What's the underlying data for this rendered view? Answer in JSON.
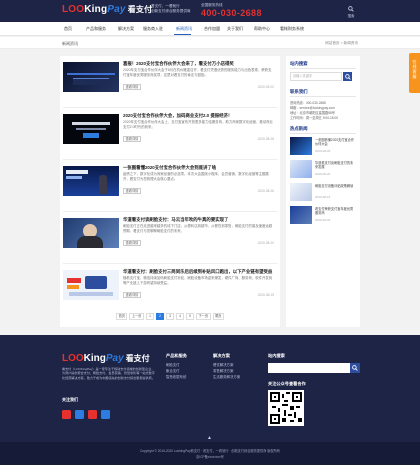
{
  "header": {
    "logo_text_a": "LOO",
    "logo_text_b": "King",
    "logo_text_c": "Pay",
    "logo_cn": "看支付",
    "slogan_line1": "看支付，一看就行",
    "slogan_line2": "创新支付综合服务提供商",
    "hotline_label": "全国服务热线",
    "hotline": "400-030-2688",
    "search_label": "搜索"
  },
  "nav": {
    "items": [
      "首页",
      "产品和服务",
      "解决方案",
      "服务商入驻",
      "合作加盟",
      "新闻资讯",
      "关于我们",
      "帮助中心",
      "看帐财务系统"
    ],
    "active_index": 5
  },
  "section": {
    "title": "新闻资讯",
    "breadcrumb": "网站首页 > 新闻资讯"
  },
  "articles": [
    {
      "title": "喜报！2020支付宝合作伙伴大会来了，看支付万小店得奖",
      "summary": "2020年支付宝合作伙伴大会于8月在杭州隆重召开，看支付凭借优秀的服务能力与出色表现，荣获支付宝年度优秀服务商奖项，这是对看支付的肯定与鼓励。",
      "more": "查看详情",
      "date": "2020-09-02"
    },
    {
      "title": "2020支付宝合作伙伴大会，加码商业支付2.0 提振经济！",
      "summary": "2020年支付宝合作伙伴大会上，支付宝宣布开放更多能力给服务商，助力商家数字化经营，推动商业支付2.0时代的到来。",
      "more": "查看详情",
      "date": "2020-08-28"
    },
    {
      "title": "一张图看懂2020支付宝合作伙伴大会到底讲了啥",
      "summary": "疫情之下，数字化成为商家经营的必选项。本次大会围绕小程序、会员营销、数字化经营等主题展开，看支付为您梳理大会核心要点。",
      "more": "查看详情",
      "date": "2020-08-26"
    },
    {
      "title": "华道看支付谈刷脸支付：马云当年吹的牛真的要实现了",
      "summary": "刷脸支付正在走进越来越多的线下门店，从便利店到超市，从餐饮到零售，刷脸支付的普及速度远超预期，看支付与您聊聊刷脸支付的未来。",
      "more": "查看详情",
      "date": "2020-08-20"
    },
    {
      "title": "华道看支付：刷脸支付三两同乐后后续到补贴风口跑出，以下产业链有望受益",
      "summary": "随着支付宝、微信持续加码刷脸支付补贴，刷脸设备市场迎来爆发，硬件厂商、服务商、软件开发商等产业链上下游有望持续受益。",
      "more": "查看详情",
      "date": "2020-08-15"
    }
  ],
  "pager": [
    "首页",
    "上一页",
    "1",
    "2",
    "3",
    "4",
    "5",
    "下一页",
    "尾页"
  ],
  "pager_current": 2,
  "sidebar": {
    "search_title": "站内搜索",
    "search_placeholder": "请输入关键字",
    "contact_title": "联系我们",
    "contact_lines": [
      "咨询热线：400-030-2688",
      "邮箱：service@lookingpay.com",
      "地址：北京市朝阳区建国路88号",
      "工作时间：周一至周五 9:00-18:00"
    ],
    "hot_title": "热点新闻",
    "hot": [
      {
        "title": "一张图看懂2020支付宝合作伙伴大会",
        "date": "2020-08-26"
      },
      {
        "title": "华道看支付谈刷脸支付的未来发展",
        "date": "2020-08-20"
      },
      {
        "title": "刷脸支付设备补贴政策解读",
        "date": "2020-08-15"
      },
      {
        "title": "看支付荣获支付宝年度优秀服务商",
        "date": "2020-09-02"
      }
    ]
  },
  "float_tab": "在线客服",
  "footer": {
    "desc": "看支付（LOOKingPay）是一家专注于移动支付领域的创新型企业，为商户提供聚合支付、刷脸支付、会员营销、智慧零售等一站式数字化经营解决方案，致力于成为中国领先的创新支付综合服务提供商。",
    "follow": "关注我们",
    "col1_title": "产品和服务",
    "col1": [
      "刷脸支付",
      "聚合支付",
      "智慧收银系统"
    ],
    "col2_title": "解决方案",
    "col2": [
      "餐饮解决方案",
      "零售解决方案",
      "生活服务解决方案"
    ],
    "search_title": "站内搜索",
    "qr_title": "关注公众号查看合作",
    "backtop": "▲",
    "copyright": "Copyright © 2016-2020 LookingPay看支付 · 看支付，一看就行 · 创新支付综合服务提供商 版权所有",
    "icp": "京ICP备xxxxxxxx号"
  },
  "colors": {
    "brand_dark": "#1d2446",
    "accent_red": "#e6312f",
    "accent_blue": "#2d7de0",
    "float_orange": "#f7941d"
  }
}
